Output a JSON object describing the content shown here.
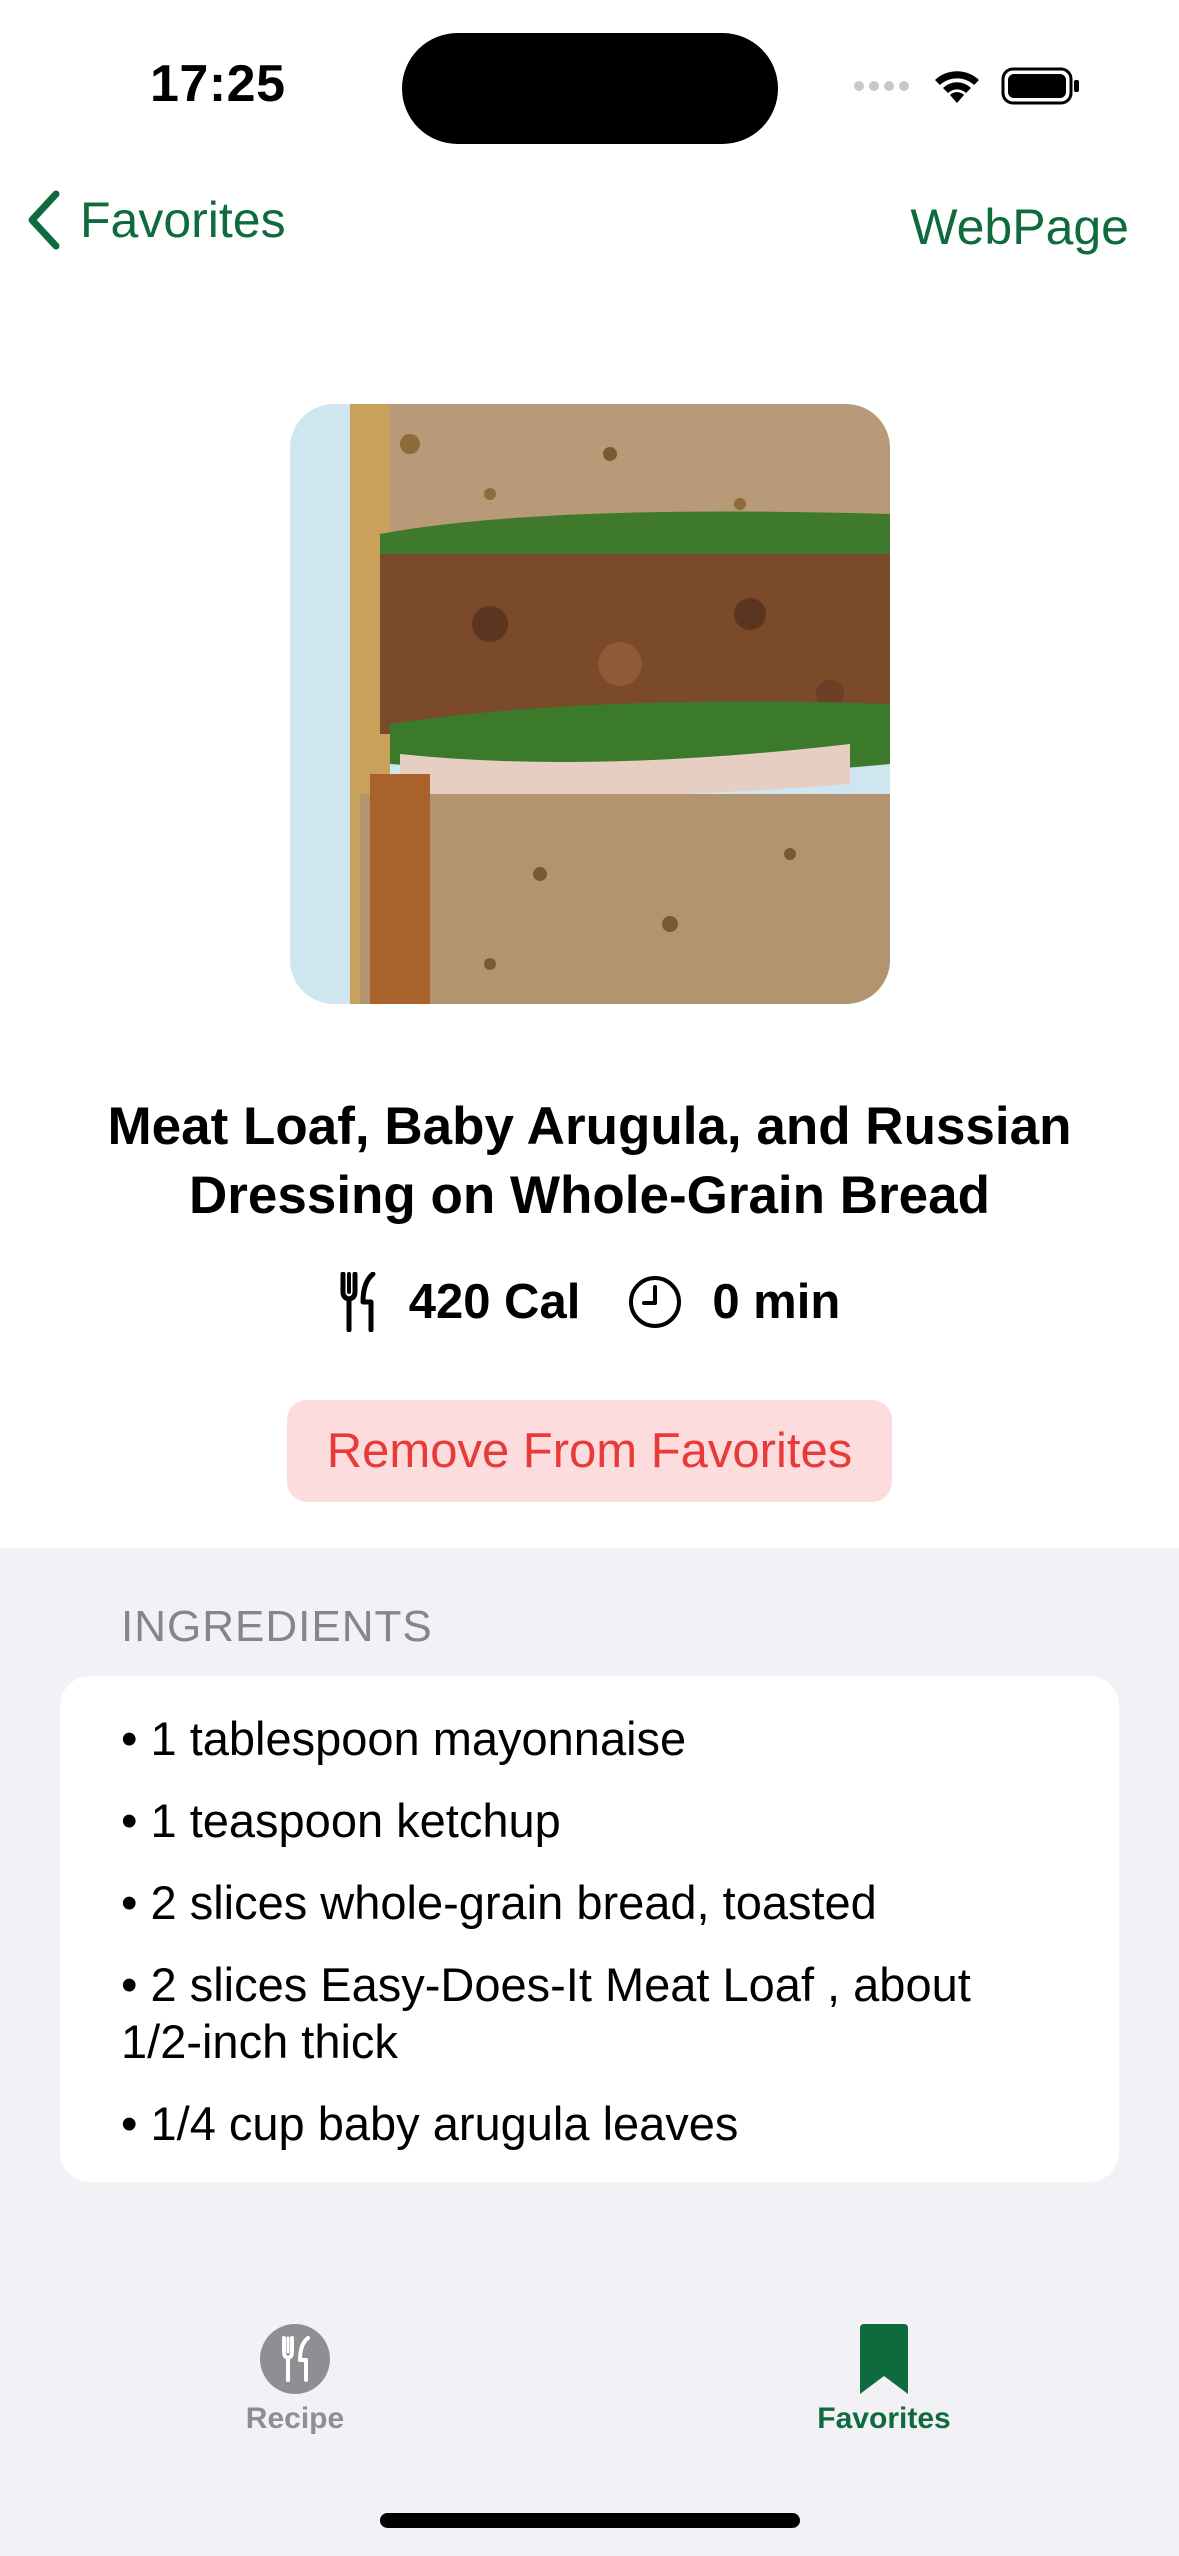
{
  "status_bar": {
    "time": "17:25"
  },
  "nav": {
    "back_label": "Favorites",
    "right_action": "WebPage",
    "accent_color": "#0f6b3e"
  },
  "recipe": {
    "title": "Meat Loaf, Baby Arugula, and Russian Dressing on Whole-Grain Bread",
    "calories": "420 Cal",
    "time": "0 min",
    "remove_button": "Remove From Favorites"
  },
  "ingredients": {
    "header": "INGREDIENTS",
    "items": [
      "• 1 tablespoon mayonnaise",
      "• 1 teaspoon ketchup",
      "• 2 slices whole-grain bread, toasted",
      "• 2 slices Easy-Does-It Meat Loaf , about 1/2-inch thick",
      "• 1/4 cup baby arugula leaves"
    ]
  },
  "tab_bar": {
    "tabs": [
      {
        "label": "Recipe",
        "icon": "fork-knife-icon",
        "selected": false
      },
      {
        "label": "Favorites",
        "icon": "bookmark-icon",
        "selected": true
      }
    ]
  },
  "colors": {
    "accent": "#0f6b3e",
    "destructive": "#e83a3a",
    "destructive_bg": "#fcdcdc",
    "grouped_background": "#f1f1f6"
  }
}
